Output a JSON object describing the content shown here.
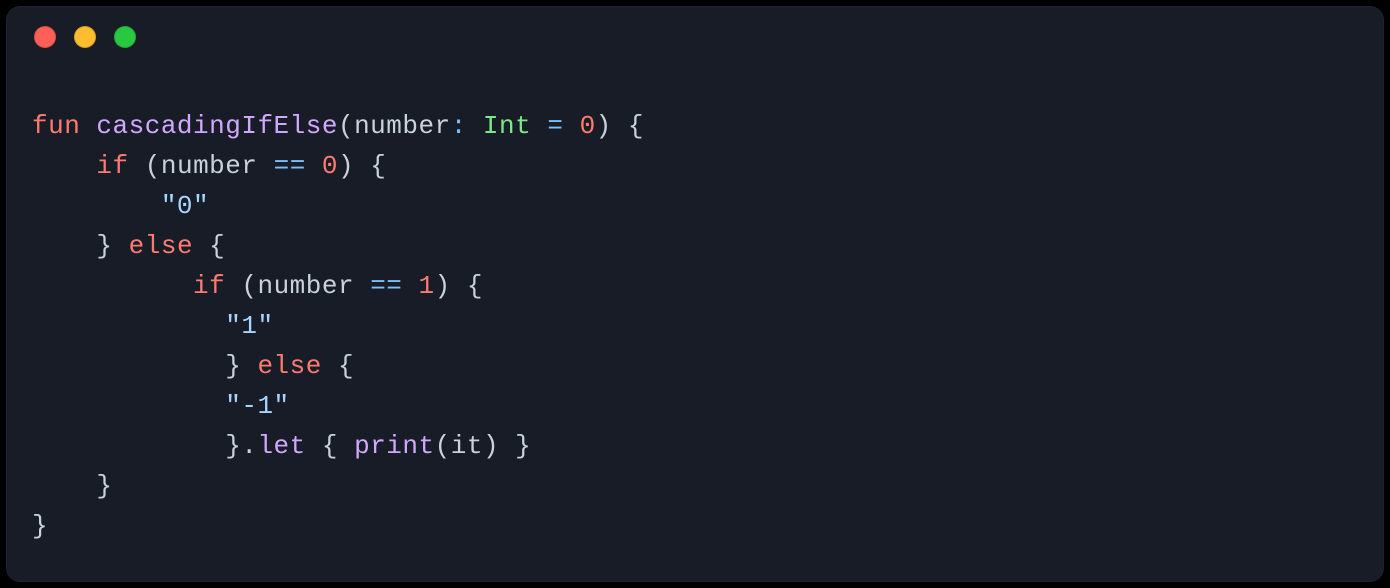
{
  "traffic_lights": {
    "red": "#ff5f57",
    "yellow": "#febc2e",
    "green": "#28c840"
  },
  "code": {
    "kw_fun": "fun",
    "fn_name": "cascadingIfElse",
    "param_name": "number",
    "type_int": "Int",
    "op_assign": "=",
    "default_val": "0",
    "kw_if": "if",
    "kw_else": "else",
    "op_eq": "==",
    "zero": "0",
    "one": "1",
    "str_zero": "\"0\"",
    "str_one": "\"1\"",
    "str_neg1": "\"-1\"",
    "method_let": "let",
    "fn_print": "print",
    "id_it": "it",
    "lbrace": "{",
    "rbrace": "}",
    "lparen": "(",
    "rparen": ")",
    "colon": ":",
    "dot": "."
  }
}
